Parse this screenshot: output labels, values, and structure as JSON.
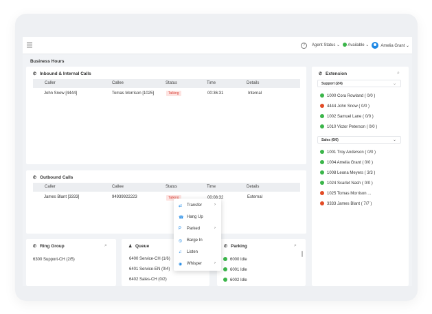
{
  "topbar": {
    "agent_status_label": "Agent Status",
    "availability_label": "Available",
    "availability_color": "#3bb54a",
    "user_name": "Amelia Grant",
    "chevron": "⌄"
  },
  "section_title": "Business Hours",
  "inbound": {
    "title": "Inbound & Internal Calls",
    "columns": [
      "Caller",
      "Callee",
      "Status",
      "Time",
      "Details"
    ],
    "rows": [
      {
        "caller": "John Snow [4444]",
        "callee": "Tomas Morrison [1025]",
        "status": "Talking",
        "time": "00:36:31",
        "details": "Internal"
      }
    ]
  },
  "outbound": {
    "title": "Outbound Calls",
    "columns": [
      "Caller",
      "Callee",
      "Status",
      "Time",
      "Details"
    ],
    "rows": [
      {
        "caller": "James Blant [3333]",
        "callee": "94939922223",
        "status": "Talking",
        "time": "00:08:32",
        "details": "External"
      }
    ]
  },
  "context_menu": {
    "items": [
      {
        "label": "Transfer",
        "icon": "transfer-icon",
        "glyph": "⇄",
        "submenu": "›"
      },
      {
        "label": "Hang Up",
        "icon": "hangup-icon",
        "glyph": "☎",
        "submenu": ""
      },
      {
        "label": "Parked",
        "icon": "parked-icon",
        "glyph": "P",
        "submenu": "›"
      },
      {
        "label": "Barge In",
        "icon": "barge-in-icon",
        "glyph": "◎",
        "submenu": ""
      },
      {
        "label": "Listen",
        "icon": "headphones-icon",
        "glyph": "♫",
        "submenu": ""
      },
      {
        "label": "Whisper",
        "icon": "whisper-icon",
        "glyph": "◉",
        "submenu": "›"
      }
    ]
  },
  "extension": {
    "title": "Extension",
    "groups": [
      {
        "label": "Support (2/4)",
        "chevron": "⌄"
      },
      {
        "label": "Sales (6/6)",
        "chevron": "⌄"
      }
    ],
    "support_items": [
      {
        "label": "1000 Cora Rowland ( 0/0 )",
        "status": "green"
      },
      {
        "label": "4444 John Snow ( 0/0 )",
        "status": "red"
      },
      {
        "label": "1002 Samuel Lane ( 0/0 )",
        "status": "green"
      },
      {
        "label": "1010 Victor Peterson ( 0/0 )",
        "status": "green"
      }
    ],
    "sales_items": [
      {
        "label": "1001 Troy Anderson ( 0/0 )",
        "status": "green"
      },
      {
        "label": "1004 Amelia Grant ( 0/0 )",
        "status": "green"
      },
      {
        "label": "1008 Leona Meyers ( 3/3 )",
        "status": "green"
      },
      {
        "label": "1024 Scarlet Nash ( 0/0 )",
        "status": "green"
      },
      {
        "label": "1025 Tomas Morrison ...",
        "status": "red"
      },
      {
        "label": "3333 James Blant ( 7/7 )",
        "status": "red"
      }
    ]
  },
  "ring_group": {
    "title": "Ring Group",
    "items": [
      "6300 Support-CH (2/5)"
    ]
  },
  "queue": {
    "title": "Queue",
    "items": [
      "6400 Service-CH (1/6)",
      "6401 Service-EN (0/4)",
      "6402 Sales-CH (0/2)"
    ]
  },
  "parking": {
    "title": "Parking",
    "items": [
      "6000 Idle",
      "6001 Idle",
      "6002 Idle"
    ]
  },
  "colors": {
    "accent": "#1e88e5",
    "available": "#3bb54a",
    "busy": "#e24b26",
    "talking_text": "#d9453b",
    "talking_bg": "#fde3e1"
  }
}
